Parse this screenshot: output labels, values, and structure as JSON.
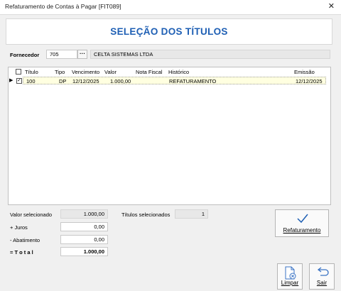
{
  "window": {
    "title": "Refaturamento de Contas à Pagar [FIT089]"
  },
  "header": {
    "title": "SELEÇÃO DOS TÍTULOS"
  },
  "fornecedor": {
    "label": "Fornecedor",
    "code": "705",
    "name": "CELTA SISTEMAS LTDA"
  },
  "grid": {
    "columns": [
      "Título",
      "Tipo",
      "Vencimento",
      "Valor",
      "Nota Fiscal",
      "Histórico",
      "Emissão"
    ],
    "rows": [
      {
        "checked": true,
        "titulo": "100",
        "tipo": "DP",
        "vencimento": "12/12/2025",
        "valor": "1.000,00",
        "nota_fiscal": "",
        "historico": "REFATURAMENTO",
        "emissao": "12/12/2025"
      }
    ]
  },
  "totals": {
    "valor_selecionado_label": "Valor selecionado",
    "valor_selecionado": "1.000,00",
    "titulos_selecionados_label": "Títulos selecionados",
    "titulos_selecionados": "1",
    "juros_label": "+ Juros",
    "juros": "0,00",
    "abatimento_label": "- Abatimento",
    "abatimento": "0,00",
    "total_label": "= T o t a l",
    "total": "1.000,00"
  },
  "buttons": {
    "refaturamento": "Refaturamento",
    "limpar": "Limpar",
    "sair": "Sair"
  },
  "colors": {
    "accent": "#1e5fb4",
    "selected_row": "#ffffe0"
  }
}
